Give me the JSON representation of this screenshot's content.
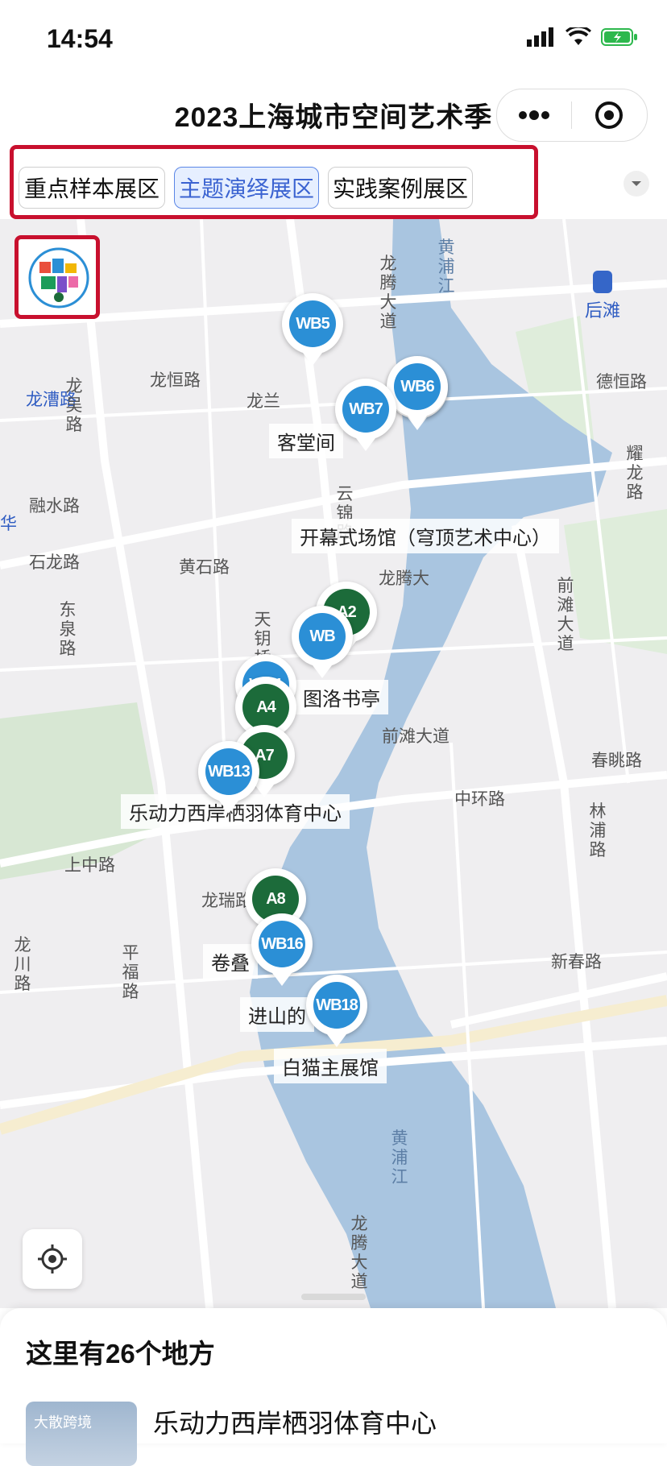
{
  "status": {
    "time": "14:54"
  },
  "header": {
    "title": "2023上海城市空间艺术季"
  },
  "tabs": [
    {
      "label": "重点样本展区",
      "active": false
    },
    {
      "label": "主题演绎展区",
      "active": true
    },
    {
      "label": "实践案例展区",
      "active": false
    }
  ],
  "map": {
    "places": [
      "客堂间",
      "开幕式场馆（穹顶艺术中心）",
      "图洛书亭",
      "乐动力西岸栖羽体育中心",
      "卷叠",
      "进山的",
      "白猫主展馆"
    ],
    "roads": [
      "龙腾大道",
      "黄浦江",
      "龙漕路",
      "龙恒路",
      "龙吴路",
      "融水路",
      "石龙路",
      "东泉路",
      "黄石路",
      "天钥桥",
      "云锦路",
      "龙腾大",
      "德恒路",
      "耀龙路",
      "后滩",
      "前滩大道",
      "前滩大道",
      "春眺路",
      "中环路",
      "林浦路",
      "上中路",
      "龙瑞路",
      "平福路",
      "龙川路",
      "新春路",
      "黄浦江",
      "龙腾大道",
      "龙兰",
      "华"
    ],
    "pins": [
      {
        "label": "WB5",
        "color": "blue"
      },
      {
        "label": "WB6",
        "color": "blue"
      },
      {
        "label": "WB7",
        "color": "blue"
      },
      {
        "label": "A2",
        "color": "green"
      },
      {
        "label": "WB",
        "color": "blue"
      },
      {
        "label": "WB1",
        "color": "blue"
      },
      {
        "label": "A4",
        "color": "green"
      },
      {
        "label": "A7",
        "color": "green"
      },
      {
        "label": "WB13",
        "color": "blue"
      },
      {
        "label": "A8",
        "color": "green"
      },
      {
        "label": "WB16",
        "color": "blue"
      },
      {
        "label": "WB18",
        "color": "blue"
      }
    ]
  },
  "sheet": {
    "count_text": "这里有26个地方",
    "first_item": "乐动力西岸栖羽体育中心",
    "thumb_text": "大散跨境"
  },
  "colors": {
    "accent": "#3b63d1",
    "highlight": "#c8102e",
    "river": "#a9c5e0",
    "pin_blue": "#2b8fd6",
    "pin_green": "#1c6b3a"
  }
}
